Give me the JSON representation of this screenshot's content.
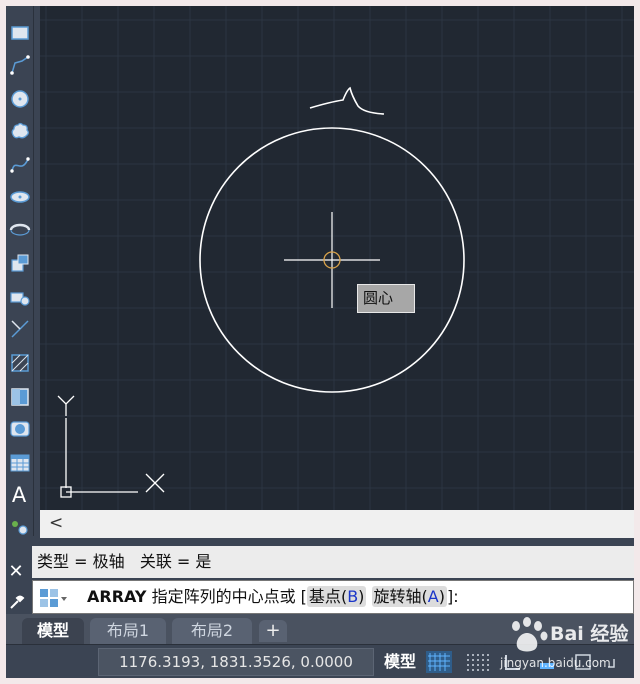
{
  "toolbar": {
    "text_tool_label": "A",
    "icons": [
      "rectangle-icon",
      "polyline-icon",
      "circle-icon",
      "cloud-icon",
      "spline-icon",
      "ellipse-icon",
      "ellipse-arc-icon",
      "insert-block-icon",
      "create-block-icon",
      "point-icon",
      "hatch-icon",
      "gradient-icon",
      "region-icon",
      "table-icon",
      "multiline-text-icon",
      "add-selected-icon"
    ]
  },
  "canvas": {
    "tooltip": "圆心",
    "ucs": {
      "y_label": "Y",
      "x_label": "X"
    },
    "colors": {
      "background": "#212832",
      "grid": "#2c3542",
      "geometry": "#ffffff",
      "snap_marker": "#d8a24a"
    }
  },
  "command": {
    "history": "类型 = 极轴   关联 = 是",
    "name": "ARRAY",
    "prompt": "指定阵列的中心点或",
    "bracket_open": "[",
    "option1_label": "基点",
    "option1_key": "B",
    "option2_label": "旋转轴",
    "option2_key": "A",
    "bracket_close": "]:",
    "close_symbol": "✕"
  },
  "tabs": {
    "items": [
      {
        "label": "模型",
        "active": true
      },
      {
        "label": "布局1",
        "active": false
      },
      {
        "label": "布局2",
        "active": false
      }
    ],
    "add_label": "+"
  },
  "status": {
    "coords": "1176.3193, 1831.3526, 0.0000",
    "mode": "模型"
  },
  "watermark": {
    "text": "Bai  经验",
    "url": "jingyan.baidu.com"
  },
  "scroll_left_arrow": "<"
}
